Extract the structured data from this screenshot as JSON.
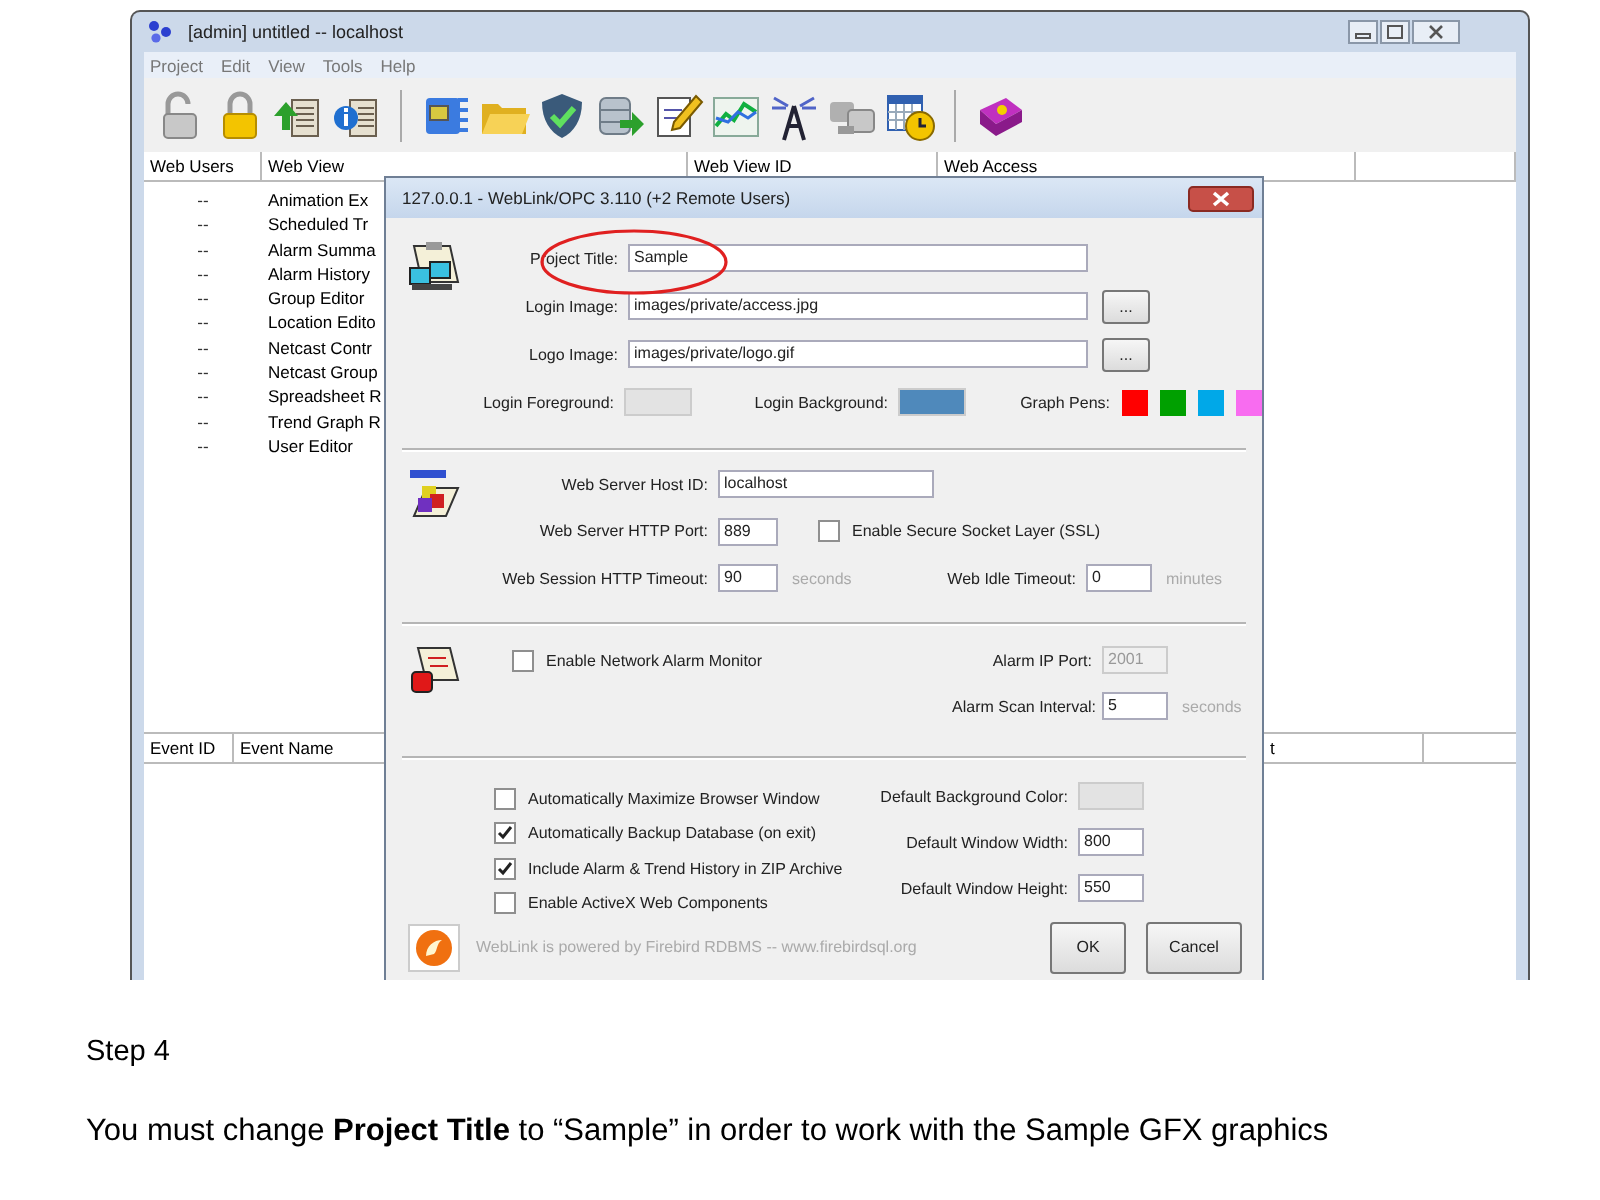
{
  "window": {
    "title": "[admin]  untitled  --  localhost"
  },
  "menu": [
    "Project",
    "Edit",
    "View",
    "Tools",
    "Help"
  ],
  "toolbar": [
    {
      "kind": "unlock"
    },
    {
      "kind": "lock"
    },
    {
      "kind": "upload"
    },
    {
      "kind": "info"
    },
    {
      "kind": "separator"
    },
    {
      "kind": "zip"
    },
    {
      "kind": "folder"
    },
    {
      "kind": "shield"
    },
    {
      "kind": "database"
    },
    {
      "kind": "edit"
    },
    {
      "kind": "chart"
    },
    {
      "kind": "antenna"
    },
    {
      "kind": "computers"
    },
    {
      "kind": "calendar"
    },
    {
      "kind": "separator"
    },
    {
      "kind": "book"
    }
  ],
  "web_table": {
    "columns": [
      "Web Users",
      "Web View",
      "Web View ID",
      "Web Access"
    ],
    "rows": [
      {
        "web_users": "--",
        "web_view": "Animation Ex"
      },
      {
        "web_users": "--",
        "web_view": "Scheduled Tr"
      },
      {
        "web_users": "--",
        "web_view": "Alarm Summa"
      },
      {
        "web_users": "--",
        "web_view": "Alarm History"
      },
      {
        "web_users": "--",
        "web_view": "Group Editor"
      },
      {
        "web_users": "--",
        "web_view": "Location Edito"
      },
      {
        "web_users": "--",
        "web_view": "Netcast Contr"
      },
      {
        "web_users": "--",
        "web_view": "Netcast Group"
      },
      {
        "web_users": "--",
        "web_view": "Spreadsheet R"
      },
      {
        "web_users": "--",
        "web_view": "Trend Graph R"
      },
      {
        "web_users": "--",
        "web_view": "User Editor"
      }
    ]
  },
  "event_table": {
    "columns": [
      "Event ID",
      "Event Name",
      "t"
    ]
  },
  "dialog": {
    "title": "127.0.0.1 - WebLink/OPC 3.110 (+2 Remote Users)",
    "project": {
      "title_label": "Project Title:",
      "title_value": "Sample",
      "login_image_label": "Login Image:",
      "login_image_value": "images/private/access.jpg",
      "login_image_browse": "...",
      "logo_image_label": "Logo Image:",
      "logo_image_value": "images/private/logo.gif",
      "logo_image_browse": "...",
      "login_foreground_label": "Login Foreground:",
      "login_background_label": "Login Background:",
      "graph_pens_label": "Graph Pens:",
      "graph_pens": [
        {
          "color": "#ff0000"
        },
        {
          "color": "#00a000"
        },
        {
          "color": "#00a8e8"
        },
        {
          "color": "#f86cf0"
        }
      ]
    },
    "web": {
      "host_label": "Web Server Host ID:",
      "host_value": "localhost",
      "port_label": "Web Server HTTP Port:",
      "port_value": "889",
      "ssl": {
        "label": "Enable Secure Socket Layer (SSL)",
        "checked": false
      },
      "session_label": "Web Session HTTP Timeout:",
      "session_value": "90",
      "session_unit": "seconds",
      "idle_label": "Web Idle Timeout:",
      "idle_value": "0",
      "idle_unit": "minutes"
    },
    "alarm": {
      "monitor": {
        "label": "Enable Network Alarm Monitor",
        "checked": false
      },
      "ip_port_label": "Alarm IP Port:",
      "ip_port_value": "2001",
      "ip_port_disabled": true,
      "scan_label": "Alarm Scan Interval:",
      "scan_value": "5",
      "scan_unit": "seconds"
    },
    "options": {
      "checkboxes": [
        {
          "label": "Automatically Maximize Browser Window",
          "checked": false
        },
        {
          "label": "Automatically Backup Database (on exit)",
          "checked": true
        },
        {
          "label": "Include Alarm & Trend History in ZIP Archive",
          "checked": true
        },
        {
          "label": "Enable ActiveX Web Components",
          "checked": false
        }
      ],
      "bg_color_label": "Default Background Color:",
      "width_label": "Default Window Width:",
      "width_value": "800",
      "height_label": "Default Window Height:",
      "height_value": "550"
    },
    "footer": {
      "powered": "WebLink is powered by Firebird RDBMS -- www.firebirdsql.org",
      "ok": "OK",
      "cancel": "Cancel"
    }
  },
  "doc": {
    "step": "Step 4",
    "instruction": "You must change **Project Title** to “Sample” in order to work with the Sample GFX graphics"
  }
}
